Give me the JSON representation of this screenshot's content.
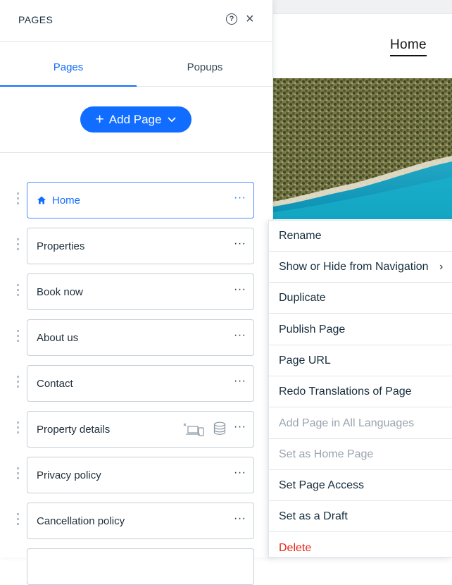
{
  "panel": {
    "title": "PAGES",
    "help_icon": "help-icon",
    "close_icon": "close-icon"
  },
  "tabs": [
    {
      "label": "Pages",
      "active": true
    },
    {
      "label": "Popups",
      "active": false
    }
  ],
  "add_page": {
    "label": "Add Page",
    "icon": "plus-icon",
    "dropdown_icon": "chevron-down-icon",
    "color": "#116dff"
  },
  "pages": [
    {
      "label": "Home",
      "icon": "home-icon",
      "selected": true
    },
    {
      "label": "Properties"
    },
    {
      "label": "Book now"
    },
    {
      "label": "About us"
    },
    {
      "label": "Contact"
    },
    {
      "label": "Property details",
      "icons": [
        "dynamic-page-icon",
        "database-icon"
      ]
    },
    {
      "label": "Privacy policy"
    },
    {
      "label": "Cancellation policy"
    }
  ],
  "more_icon": "more-actions-icon",
  "site_preview": {
    "nav_item": "Home"
  },
  "context_menu": {
    "items": [
      {
        "label": "Rename"
      },
      {
        "label": "Show or Hide from Navigation",
        "submenu": true
      },
      {
        "label": "Duplicate"
      },
      {
        "label": "Publish Page"
      },
      {
        "label": "Page URL"
      },
      {
        "label": "Redo Translations of Page"
      },
      {
        "label": "Add Page in All Languages",
        "disabled": true
      },
      {
        "label": "Set as Home Page",
        "disabled": true
      },
      {
        "label": "Set Page Access"
      },
      {
        "label": "Set as a Draft"
      },
      {
        "label": "Delete",
        "danger": true
      }
    ],
    "danger_color": "#e62214"
  }
}
